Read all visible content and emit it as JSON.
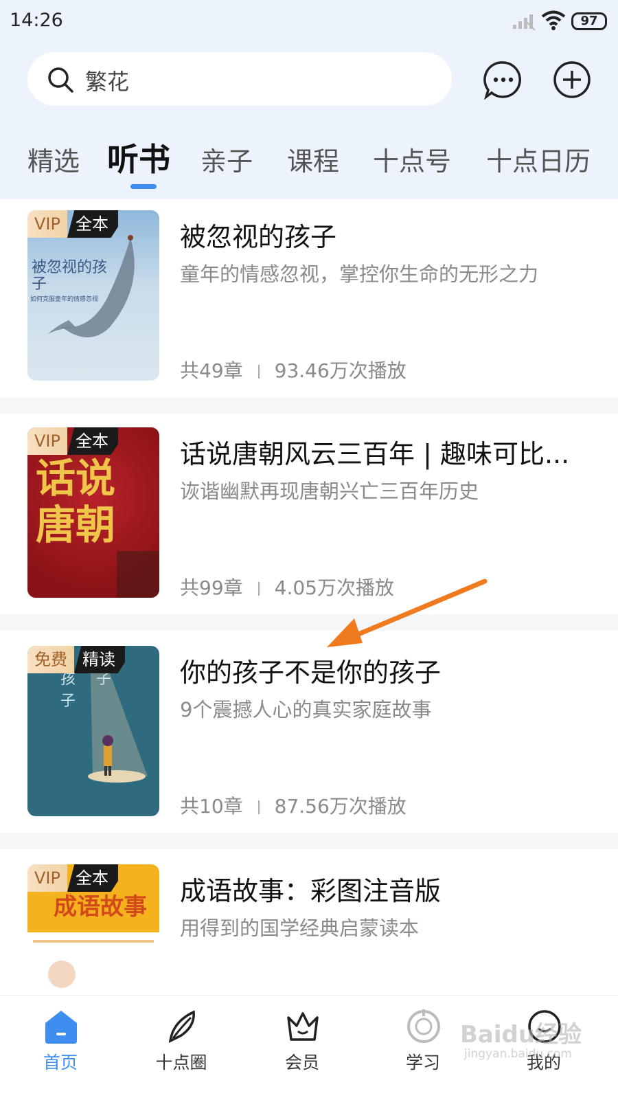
{
  "status": {
    "time": "14:26",
    "battery": "97"
  },
  "search": {
    "query": "繁花"
  },
  "tabs": [
    {
      "label": "精选"
    },
    {
      "label": "听书"
    },
    {
      "label": "亲子"
    },
    {
      "label": "课程"
    },
    {
      "label": "十点号"
    },
    {
      "label": "十点日历"
    }
  ],
  "books": [
    {
      "badge1": "VIP",
      "badge2": "全本",
      "title": "被忽视的孩子",
      "desc": "童年的情感忽视，掌控你生命的无形之力",
      "chapters": "共49章",
      "plays": "93.46万次播放",
      "cover_text": "被忽视的孩子",
      "cover_sub": "如何克服童年的情感忽视"
    },
    {
      "badge1": "VIP",
      "badge2": "全本",
      "title": "话说唐朝风云三百年 | 趣味可比...",
      "desc": "诙谐幽默再现唐朝兴亡三百年历史",
      "chapters": "共99章",
      "plays": "4.05万次播放",
      "cover_text": "话说唐朝"
    },
    {
      "badge1": "免费",
      "badge2": "精读",
      "title": "你的孩子不是你的孩子",
      "desc": "9个震撼人心的真实家庭故事",
      "chapters": "共10章",
      "plays": "87.56万次播放",
      "cover_text": "孩子 子"
    },
    {
      "badge1": "VIP",
      "badge2": "全本",
      "title": "成语故事：彩图注音版",
      "desc": "用得到的国学经典启蒙读本",
      "chapters": "",
      "plays": "",
      "cover_text": "成语故事"
    }
  ],
  "tabbar": [
    {
      "label": "首页"
    },
    {
      "label": "十点圈"
    },
    {
      "label": "会员"
    },
    {
      "label": "学习"
    },
    {
      "label": "我的"
    }
  ],
  "watermark": {
    "main": "Baidu经验",
    "sub": "jingyan.baidu.com"
  }
}
